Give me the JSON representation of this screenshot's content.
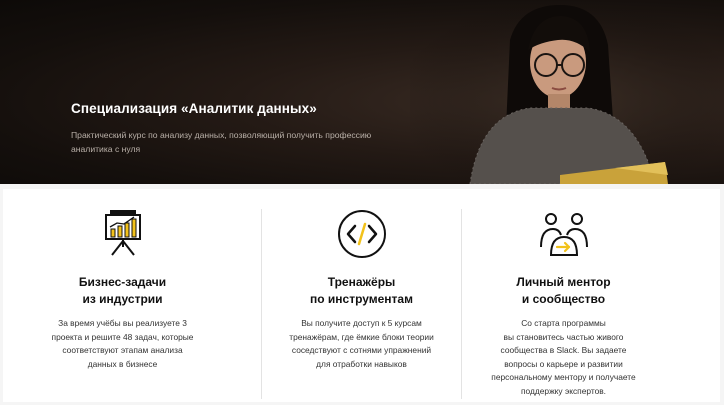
{
  "hero": {
    "title": "Специализация «Аналитик данных»",
    "subtitle_line1": "Практический курс по анализу данных, позволяющий получить профессию",
    "subtitle_line2": "аналитика с нуля"
  },
  "features": [
    {
      "icon": "presentation-chart-icon",
      "title_line1": "Бизнес-задачи",
      "title_line2": "из индустрии",
      "desc": [
        "За время учёбы вы реализуете 3",
        "проекта и решите  48 задач, которые",
        "соответствуют этапам анализа",
        "данных в бизнесе"
      ]
    },
    {
      "icon": "code-brackets-icon",
      "title_line1": "Тренажёры",
      "title_line2": "по инструментам",
      "desc": [
        "Вы получите доступ к 5 курсам",
        "тренажёрам, где ёмкие блоки теории",
        "соседствуют с сотнями упражнений",
        "для отработки навыков"
      ]
    },
    {
      "icon": "mentor-community-icon",
      "title_line1": "Личный ментор",
      "title_line2": "и сообщество",
      "desc": [
        "Со старта программы",
        "вы становитесь частью живого",
        "сообщества в Slack. Вы задаете",
        "вопросы о карьере и развитии",
        "персональному ментору и получаете",
        "поддержку экспертов."
      ]
    }
  ],
  "colors": {
    "accent": "#f2c21b",
    "hero_bg": "#1a1310"
  }
}
